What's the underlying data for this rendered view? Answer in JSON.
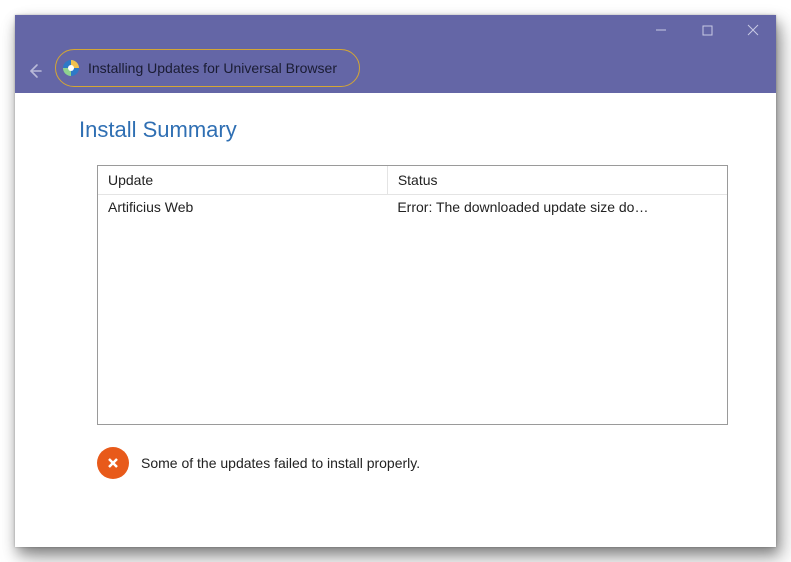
{
  "titlebar": {
    "title": "Installing Updates for Universal Browser"
  },
  "page": {
    "heading": "Install Summary"
  },
  "table": {
    "headers": {
      "update": "Update",
      "status": "Status"
    },
    "rows": [
      {
        "update": "Artificius Web",
        "status": "Error: The downloaded update size do…"
      }
    ]
  },
  "summary": {
    "message": "Some of the updates failed to install properly."
  }
}
